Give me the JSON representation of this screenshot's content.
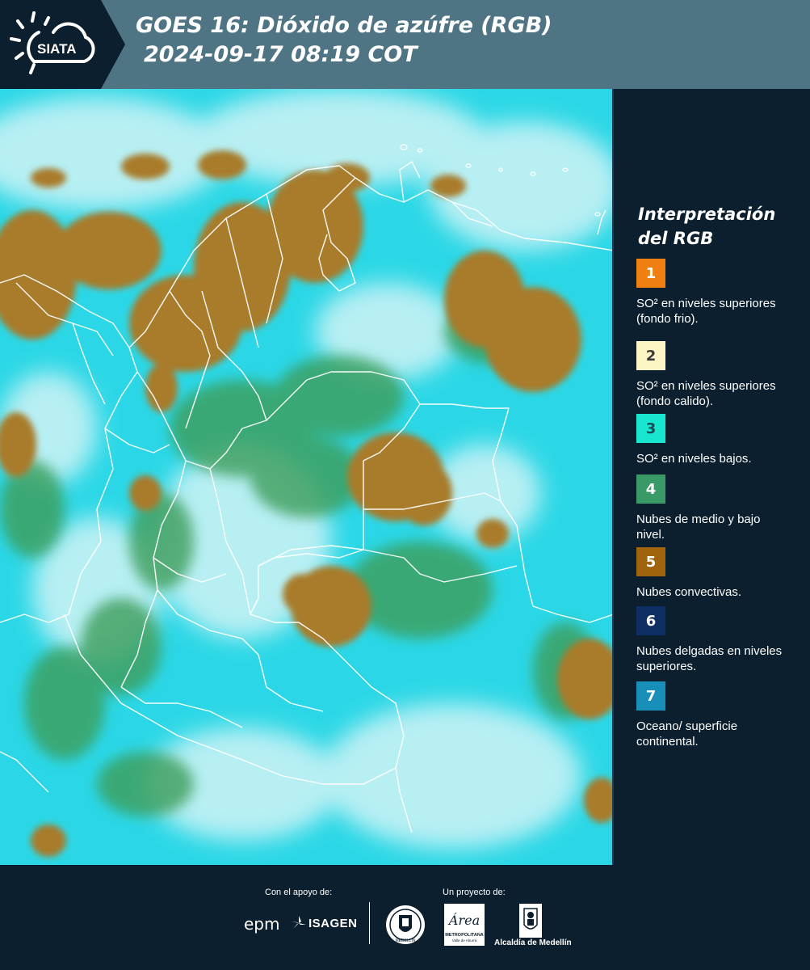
{
  "header": {
    "title_line1": "GOES 16: Dióxido de azúfre (RGB)",
    "title_line2": "2024-09-17 08:19 COT",
    "logo_text": "SIATA",
    "band_color": "#4f7585"
  },
  "legend": {
    "title": "Interpretación del RGB",
    "items": [
      {
        "num": "1",
        "color": "#f07f12",
        "text_color": "#ffffff",
        "label": "SO² en niveles superiores (fondo frio)."
      },
      {
        "num": "2",
        "color": "#fbf6c4",
        "text_color": "#3b3b3b",
        "label": "SO² en niveles superiores (fondo calido)."
      },
      {
        "num": "3",
        "color": "#19e6cf",
        "text_color": "#1a4a55",
        "label": "SO² en niveles bajos."
      },
      {
        "num": "4",
        "color": "#3a9a67",
        "text_color": "#ffffff",
        "label": "Nubes de medio y bajo nivel."
      },
      {
        "num": "5",
        "color": "#a0650c",
        "text_color": "#ffffff",
        "label": "Nubes convectivas."
      },
      {
        "num": "6",
        "color": "#0e2f63",
        "text_color": "#ffffff",
        "label": "Nubes delgadas en niveles superiores."
      },
      {
        "num": "7",
        "color": "#178fb8",
        "text_color": "#ffffff",
        "label": "Oceano/ superficie continental."
      }
    ]
  },
  "footer": {
    "support_label": "Con el apoyo de:",
    "project_label": "Un proyecto de:",
    "epm": "epm",
    "isagen": "ISAGEN",
    "metropolitana_1": "METROPOLITANA",
    "metropolitana_2": "Valle de Aburrá",
    "area": "Área",
    "alcaldia": "Alcaldía de Medellín",
    "medellin_seal": "MEDELLÍN"
  },
  "colors": {
    "ocean_cyan": "#2bd7e6",
    "land_brown": "#a87c2a",
    "cloud_white": "#e3f6f8",
    "green_cloud": "#3e9d5a",
    "background": "#0c1f2e"
  }
}
